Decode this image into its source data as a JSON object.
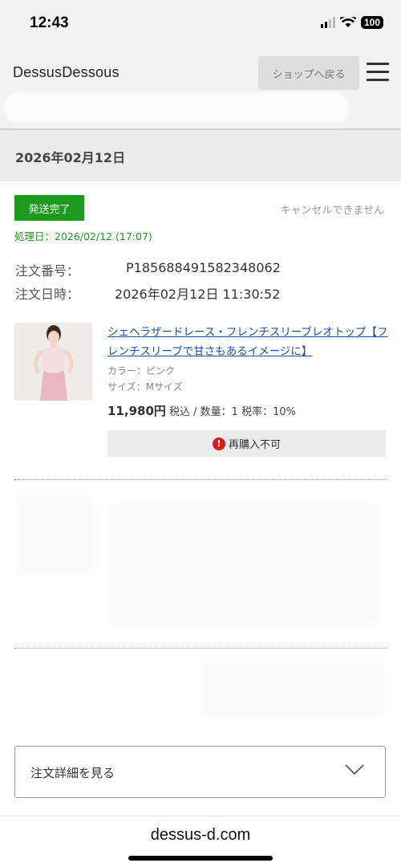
{
  "status_bar": {
    "time": "12:43",
    "battery": "100"
  },
  "header": {
    "brand": "DessusDessous",
    "shop_back_label": "ショップへ戻る"
  },
  "order_date_heading": "2026年02月12日",
  "order": {
    "status": "発送完了",
    "cancel_note": "キャンセルできません",
    "processed": "処理日：2026/02/12 (17:07)",
    "number_label": "注文番号：",
    "number_value": "P185688491582348062",
    "datetime_label": "注文日時：",
    "datetime_value": "2026年02月12日 11:30:52"
  },
  "product": {
    "title": "シェヘラザードレース・フレンチスリーブレオトップ【フレンチスリーブで甘さもあるイメージに】",
    "color": "カラー：ピンク",
    "size": "サイズ：Mサイズ",
    "price": "11,980円",
    "price_details": "税込 / 数量：1 税率：10%",
    "rebuy_label": "再購入不可"
  },
  "details_button": "注文詳細を見る",
  "browser": {
    "url": "dessus-d.com"
  },
  "colors": {
    "status_green": "#1d9a1d",
    "link_blue": "#1a4fa3",
    "alert_red": "#d81b1b"
  }
}
